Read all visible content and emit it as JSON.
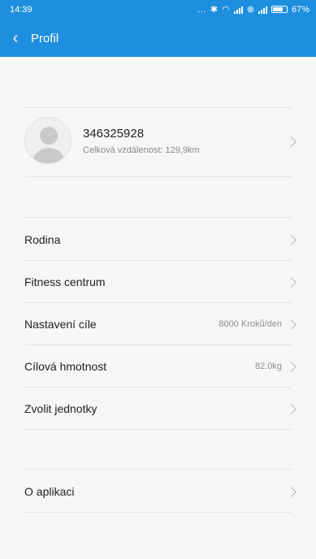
{
  "status_bar": {
    "time": "14:39",
    "battery": "67%"
  },
  "header": {
    "title": "Profil"
  },
  "profile": {
    "id": "346325928",
    "distance": "Celková vzdálenost: 129,9km"
  },
  "menu": [
    {
      "label": "Rodina",
      "value": ""
    },
    {
      "label": "Fitness centrum",
      "value": ""
    },
    {
      "label": "Nastavení cíle",
      "value": "8000 Kroků/den"
    },
    {
      "label": "Cílová hmotnost",
      "value": "82.0kg"
    },
    {
      "label": "Zvolit jednotky",
      "value": ""
    }
  ],
  "about": {
    "label": "O aplikaci"
  },
  "colors": {
    "accent": "#1e8fde",
    "background": "#f6f6f6"
  },
  "icons": [
    "back-arrow-icon",
    "chevron-right-icon",
    "avatar-placeholder-icon",
    "bluetooth-icon",
    "wifi-icon",
    "signal-icon",
    "alarm-icon",
    "battery-icon"
  ]
}
